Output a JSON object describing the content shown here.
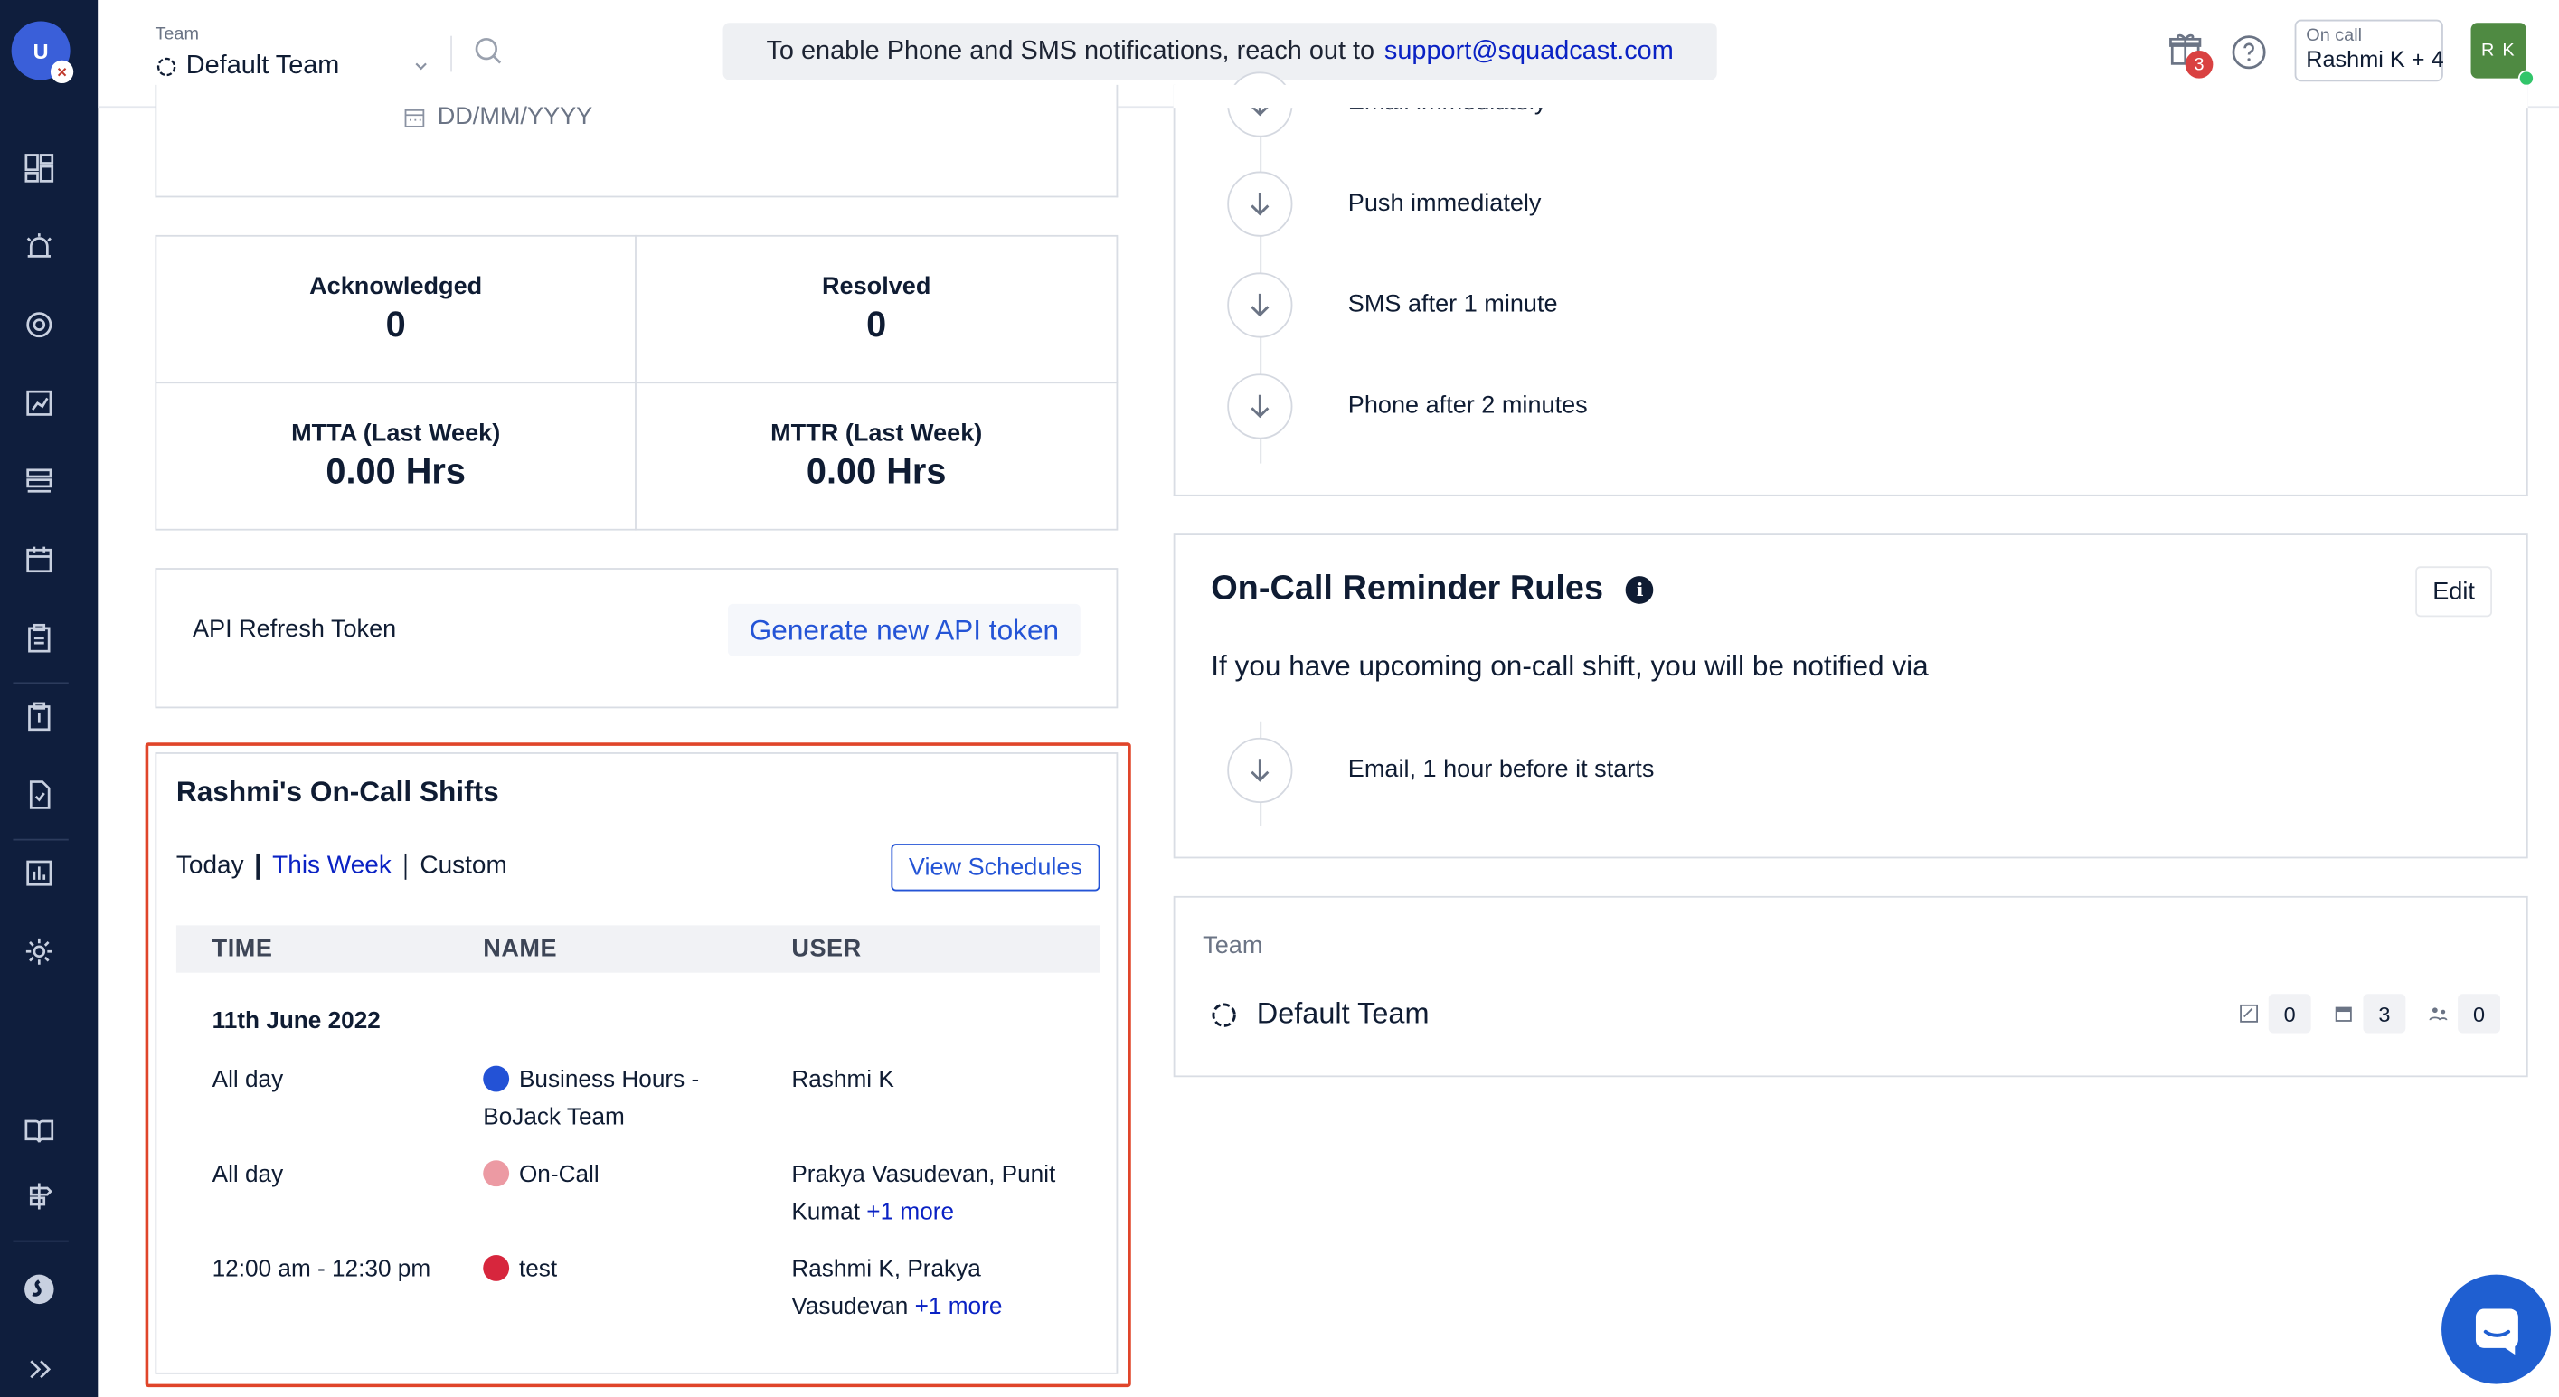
{
  "header": {
    "team_label": "Team",
    "team_value": "Default Team",
    "banner_text": "To enable Phone and SMS notifications, reach out to",
    "banner_link": "support@squadcast.com",
    "gift_count": "3",
    "oncall_label": "On call",
    "oncall_value": "Rashmi K + 4",
    "user_initials": "R K"
  },
  "sidebar": {
    "avatar": "U"
  },
  "date_card": {
    "placeholder": "DD/MM/YYYY"
  },
  "stats": {
    "ack_label": "Acknowledged",
    "ack_value": "0",
    "res_label": "Resolved",
    "res_value": "0",
    "mtta_label": "MTTA (Last Week)",
    "mtta_value": "0.00 Hrs",
    "mttr_label": "MTTR (Last Week)",
    "mttr_value": "0.00 Hrs"
  },
  "api": {
    "label": "API Refresh Token",
    "button": "Generate new API token"
  },
  "shifts": {
    "title": "Rashmi's On-Call Shifts",
    "filter_today": "Today",
    "filter_week": "This Week",
    "filter_custom": "Custom",
    "view_button": "View Schedules",
    "col_time": "TIME",
    "col_name": "NAME",
    "col_user": "USER",
    "date": "11th June 2022",
    "rows": [
      {
        "time": "All day",
        "name": "Business Hours - BoJack Team",
        "user": "Rashmi K",
        "more": "",
        "color": "#2352d6"
      },
      {
        "time": "All day",
        "name": "On-Call",
        "user": "Prakya Vasudevan, Punit Kumat",
        "more": "+1 more",
        "color": "#ec9aa3"
      },
      {
        "time": "12:00 am - 12:30 pm",
        "name": "test",
        "user": "Rashmi K, Prakya Vasudevan",
        "more": "+1 more",
        "color": "#d7263d"
      }
    ]
  },
  "notification_rules": {
    "steps": [
      "Email immediately",
      "Push immediately",
      "SMS after 1 minute",
      "Phone after 2 minutes"
    ]
  },
  "reminder": {
    "title": "On-Call Reminder Rules",
    "edit": "Edit",
    "desc": "If you have upcoming on-call shift, you will be notified via",
    "step": "Email, 1 hour before it starts"
  },
  "team_card": {
    "label": "Team",
    "name": "Default Team",
    "count1": "0",
    "count2": "3",
    "count3": "0"
  },
  "colors": {
    "sidebar": "#0f1e3d",
    "link": "#0a22c4",
    "highlight": "#e0452a"
  }
}
